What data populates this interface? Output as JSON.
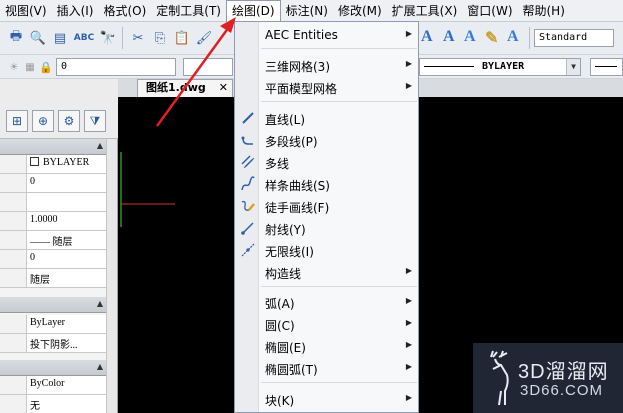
{
  "menubar": {
    "items": [
      {
        "label": "视图(V)"
      },
      {
        "label": "插入(I)"
      },
      {
        "label": "格式(O)"
      },
      {
        "label": "定制工具(T)"
      },
      {
        "label": "绘图(D)"
      },
      {
        "label": "标注(N)"
      },
      {
        "label": "修改(M)"
      },
      {
        "label": "扩展工具(X)"
      },
      {
        "label": "窗口(W)"
      },
      {
        "label": "帮助(H)"
      }
    ],
    "active_index": 4
  },
  "toolbar": {
    "text_style_value": "Standard",
    "layer_value": "0",
    "linetype_value": "BYLAYER"
  },
  "drawing_tab": {
    "label": "图纸1.dwg",
    "close_glyph": "✕"
  },
  "properties": {
    "rows_a": [
      "BYLAYER",
      "0",
      "",
      "1.0000",
      "—— 随层",
      "0",
      "随层"
    ],
    "rows_b": [
      "ByLayer",
      "投下阴影..."
    ],
    "rows_c": [
      "ByColor",
      "无"
    ]
  },
  "draw_menu": {
    "items": [
      {
        "label": "AEC Entities",
        "submenu": true,
        "icon": ""
      },
      {
        "label": "三维网格(3)",
        "submenu": true,
        "icon": ""
      },
      {
        "label": "平面模型网格",
        "submenu": true,
        "icon": ""
      },
      {
        "label": "直线(L)",
        "submenu": false,
        "icon": "line-icon"
      },
      {
        "label": "多段线(P)",
        "submenu": false,
        "icon": "polyline-icon"
      },
      {
        "label": "多线",
        "submenu": false,
        "icon": "multiline-icon"
      },
      {
        "label": "样条曲线(S)",
        "submenu": false,
        "icon": "spline-icon"
      },
      {
        "label": "徒手画线(F)",
        "submenu": false,
        "icon": "freehand-icon"
      },
      {
        "label": "射线(Y)",
        "submenu": false,
        "icon": "ray-icon"
      },
      {
        "label": "无限线(I)",
        "submenu": false,
        "icon": "xline-icon"
      },
      {
        "label": "构造线",
        "submenu": true,
        "icon": ""
      },
      {
        "label": "弧(A)",
        "submenu": true,
        "icon": ""
      },
      {
        "label": "圆(C)",
        "submenu": true,
        "icon": ""
      },
      {
        "label": "椭圆(E)",
        "submenu": true,
        "icon": ""
      },
      {
        "label": "椭圆弧(T)",
        "submenu": true,
        "icon": ""
      },
      {
        "label": "块(K)",
        "submenu": true,
        "icon": ""
      }
    ],
    "submenu_glyph": "▶"
  },
  "watermark": {
    "title": "3D溜溜网",
    "url": "3D66.COM"
  },
  "colors": {
    "annotation_arrow": "#e02020",
    "drawing_bg": "#000000",
    "menu_bg": "#f7f8fa"
  }
}
